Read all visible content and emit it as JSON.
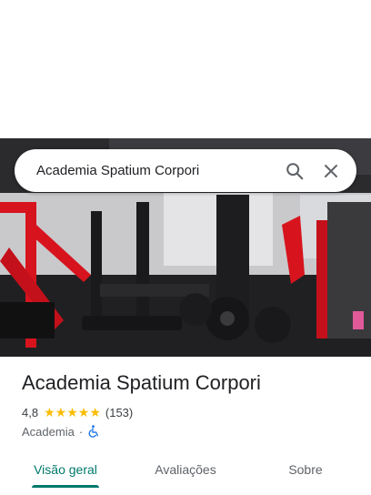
{
  "search": {
    "query": "Academia Spatium Corpori",
    "search_icon": "search-icon",
    "close_icon": "close-icon"
  },
  "hero_photo": {
    "subject": "gym-equipment-photo"
  },
  "place": {
    "name": "Academia Spatium Corpori",
    "rating": "4,8",
    "stars": 5,
    "reviews": "(153)",
    "category": "Academia",
    "separator": "·",
    "accessibility_icon": "wheelchair-icon"
  },
  "tabs": [
    {
      "label": "Visão geral",
      "active": true
    },
    {
      "label": "Avaliações",
      "active": false
    },
    {
      "label": "Sobre",
      "active": false
    }
  ],
  "colors": {
    "accent": "#00796b",
    "star": "#fbbc04",
    "accessibility": "#1a73e8"
  }
}
